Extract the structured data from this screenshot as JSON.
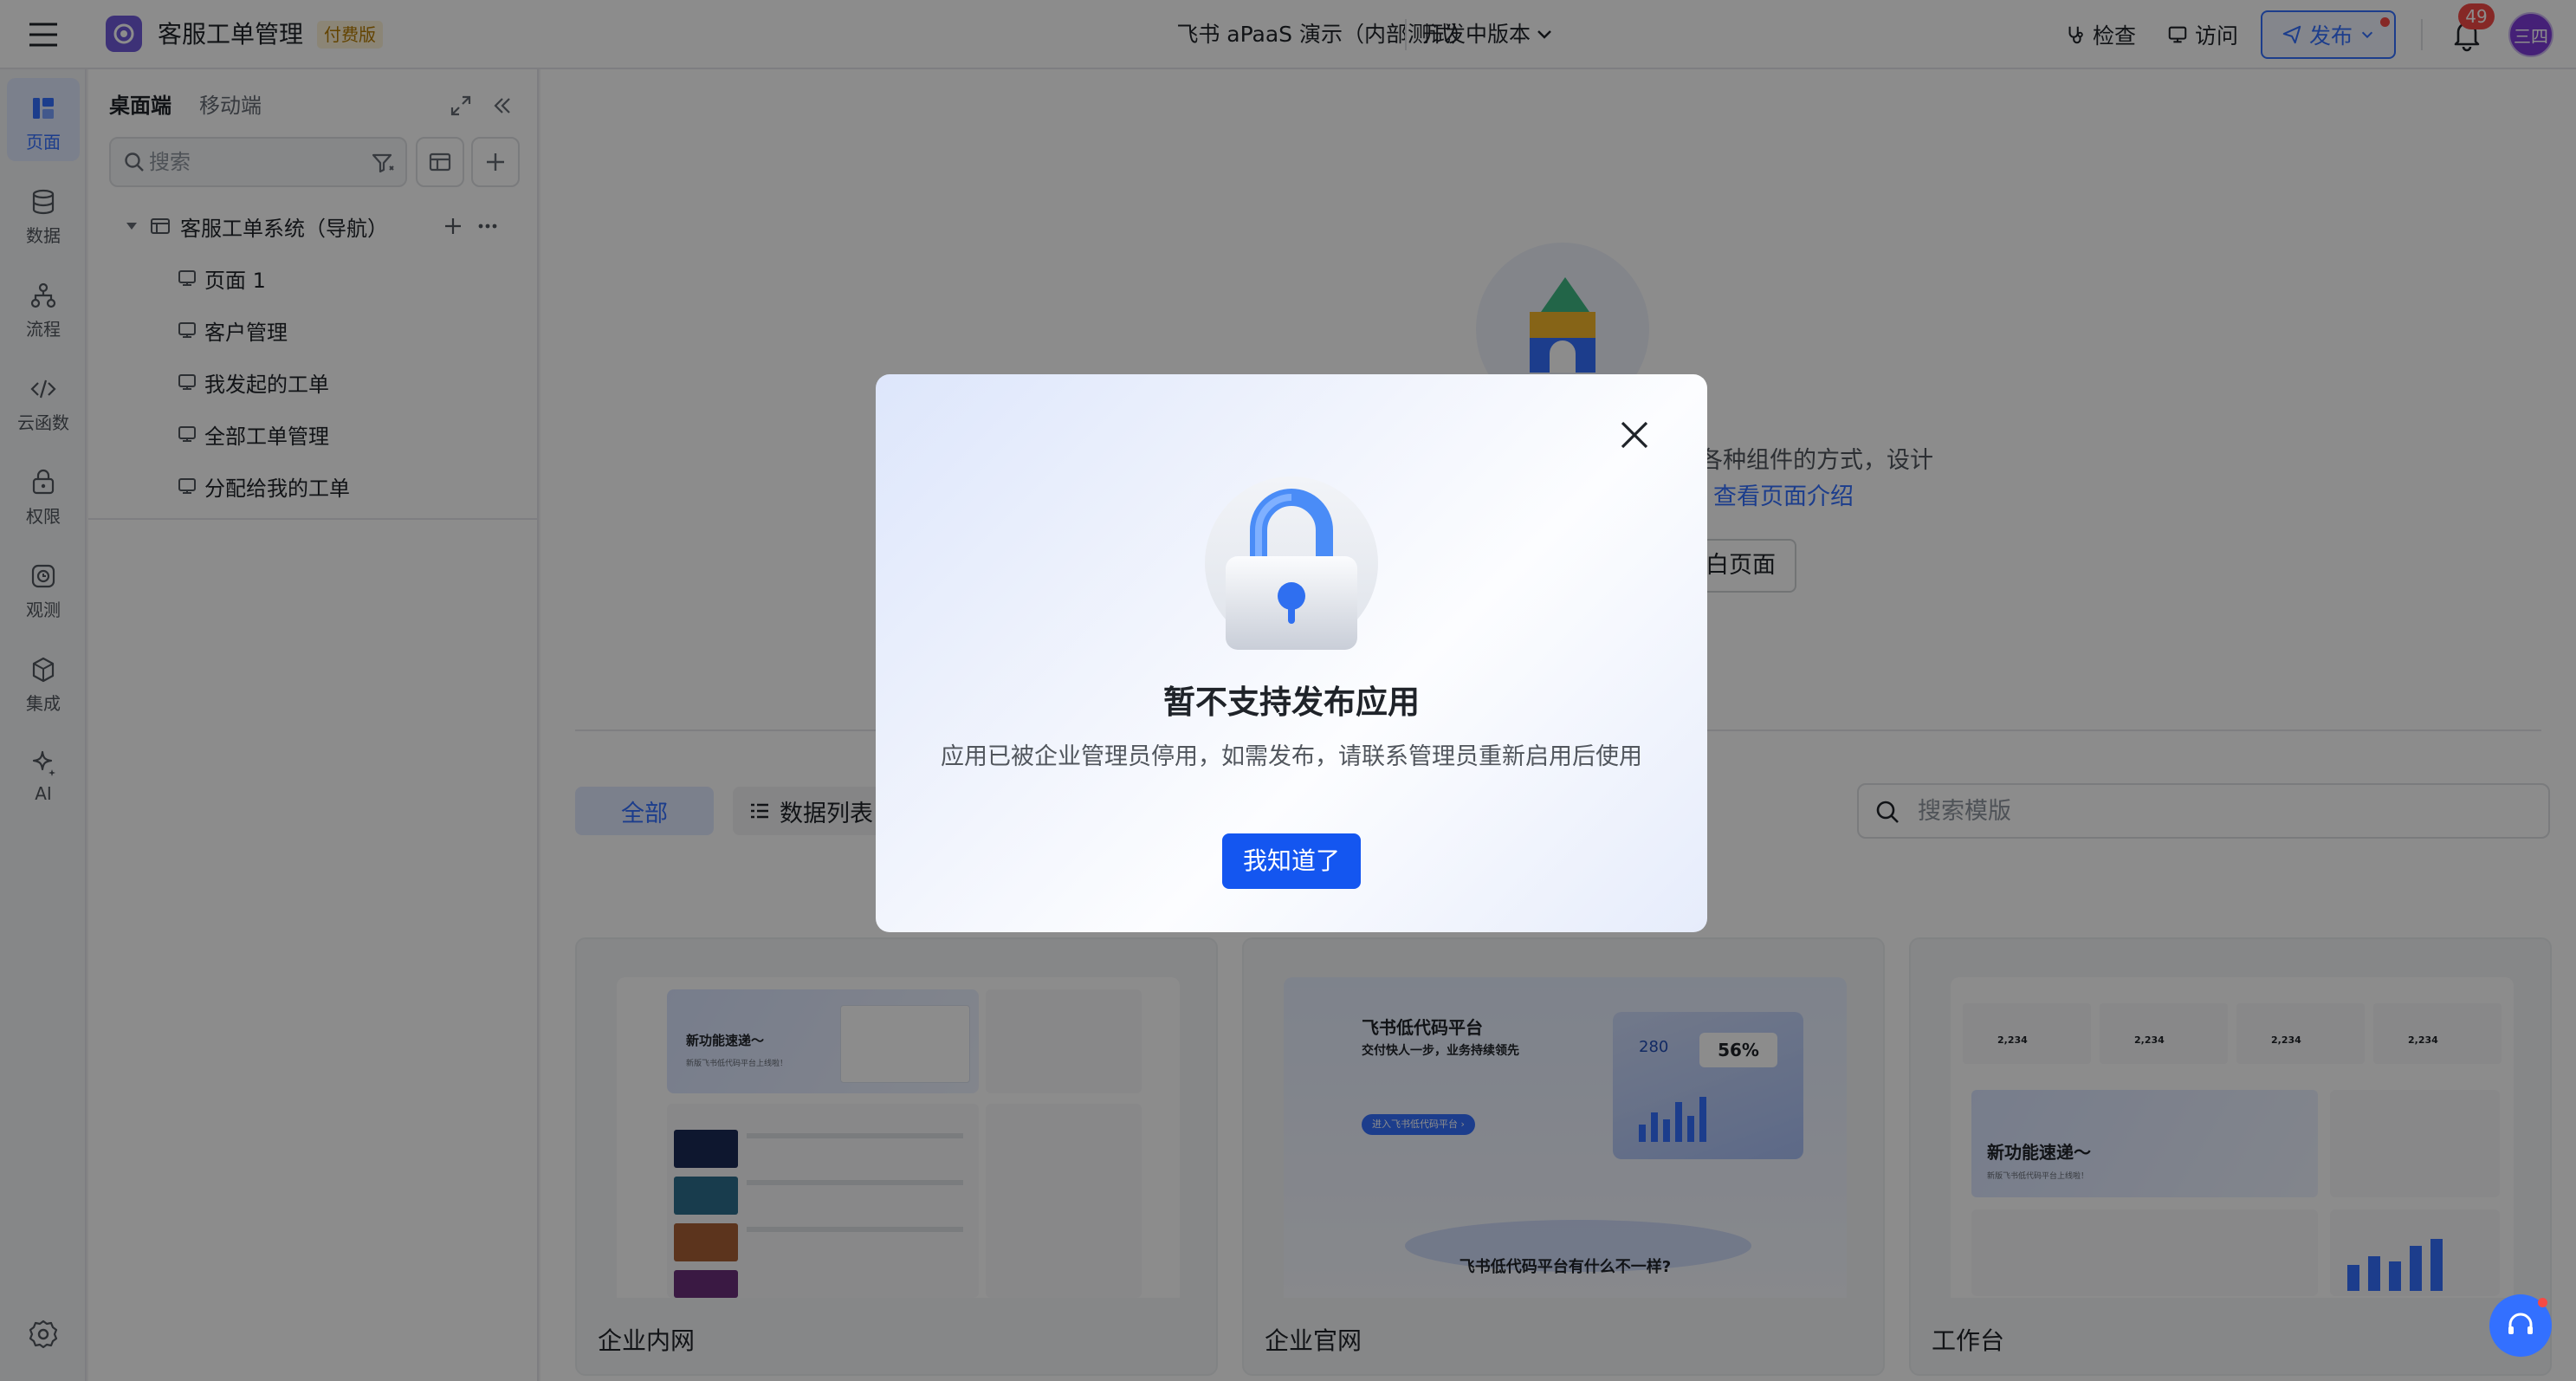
{
  "header": {
    "app_name": "客服工单管理",
    "paid_badge": "付费版",
    "env_name": "飞书 aPaaS 演示（内部测试）",
    "version_label": "开发中版本",
    "check_label": "检查",
    "visit_label": "访问",
    "publish_label": "发布",
    "notification_count": "49",
    "avatar_text": "三四",
    "accent": "#3370ff"
  },
  "rail": {
    "items": [
      {
        "label": "页面",
        "icon": "page-icon"
      },
      {
        "label": "数据",
        "icon": "database-icon"
      },
      {
        "label": "流程",
        "icon": "flow-icon"
      },
      {
        "label": "云函数",
        "icon": "code-icon"
      },
      {
        "label": "权限",
        "icon": "permission-icon"
      },
      {
        "label": "观测",
        "icon": "monitor-icon"
      },
      {
        "label": "集成",
        "icon": "integration-icon"
      },
      {
        "label": "AI",
        "icon": "ai-sparkle-icon"
      }
    ],
    "settings_icon": "settings-icon"
  },
  "panel": {
    "tabs": [
      "桌面端",
      "移动端"
    ],
    "search_placeholder": "搜索",
    "tree": {
      "root_label": "客服工单系统（导航）",
      "pages": [
        "页面 1",
        "客户管理",
        "我发起的工单",
        "全部工单管理",
        "分配给我的工单"
      ]
    }
  },
  "main": {
    "intro_text": "各种组件的方式，设计",
    "intro_link": "查看页面介绍",
    "blank_page_button": "白页面",
    "categories": [
      "全部",
      "数据列表"
    ],
    "template_search_placeholder": "搜索模版",
    "templates": [
      {
        "label": "企业内网",
        "preview": {
          "banner": "新功能速递～",
          "sub": "新版飞书低代码平台上线啦！"
        }
      },
      {
        "label": "企业官网",
        "preview": {
          "title": "飞书低代码平台",
          "subtitle": "交付快人一步，业务持续领先",
          "cta": "进入飞书低代码平台 ›",
          "metric1": "280",
          "metric2": "56%",
          "caption": "飞书低代码平台有什么不一样?"
        }
      },
      {
        "label": "工作台",
        "preview": {
          "banner": "新功能速递～",
          "sub": "新版飞书低代码平台上线啦！",
          "stats": [
            "2,234",
            "2,234",
            "2,234",
            "2,234"
          ]
        }
      }
    ]
  },
  "modal": {
    "title": "暂不支持发布应用",
    "description": "应用已被企业管理员停用，如需发布，请联系管理员重新启用后使用",
    "confirm_label": "我知道了"
  }
}
